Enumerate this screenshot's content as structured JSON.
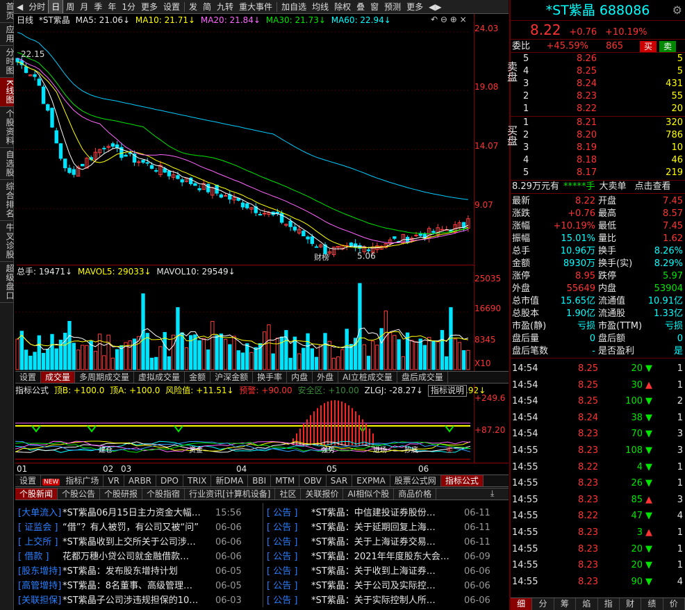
{
  "leftnav": [
    "首页",
    "应用",
    "分时图",
    "K线图",
    "个股资料",
    "自选股",
    "综合排名",
    "牛叉诊股",
    "超级盘口"
  ],
  "toolbar": [
    "分时",
    "日",
    "周",
    "月",
    "季",
    "年",
    "1分",
    "更多",
    "设置",
    "发",
    "简",
    "九转",
    "重大事件",
    "加自选",
    "均线",
    "除权",
    "叠",
    "窗",
    "预测",
    "更多"
  ],
  "kline": {
    "period": "日线",
    "name": "*ST紫晶",
    "ma5": "MA5: 21.06↓",
    "ma10": "MA10: 21.71↓",
    "ma20": "MA20: 21.84↓",
    "ma30": "MA30: 21.73↓",
    "ma60": "MA60: 22.94↓",
    "yticks": [
      "24.03",
      "19.08",
      "14.07",
      "9.07"
    ],
    "high_label": "22.15",
    "low_label": "5.06",
    "event_label": "财榜"
  },
  "volume": {
    "title": "总手: 19471↓",
    "mavol5": "MAVOL5: 29033↓",
    "mavol10": "MAVOL10: 29549↓",
    "yticks": [
      "25035",
      "16690",
      "8345"
    ],
    "unit": "X10"
  },
  "vol_tabs": [
    "设置",
    "成交量",
    "多周期成交量",
    "虚拟成交量",
    "金额",
    "沪深金额",
    "换手率",
    "内盘",
    "外盘",
    "AI立桩成交量",
    "盘后成交量"
  ],
  "indicator": {
    "title": "指标公式",
    "b": "顶B: +100.0",
    "a": "顶A: +100.0",
    "risk": "风险值: +11.51↓",
    "warn": "预警: +90.00",
    "safe": "安全区: +10.00",
    "zlgj": "ZLGJ: -28.27↓",
    "mazl": "MAZL: -7.92↓",
    "desc": "指标说明",
    "yticks": [
      "+249.6",
      "+87.20"
    ],
    "marks": [
      "建仓",
      "资金",
      "强势",
      "进场",
      "抄底",
      "卖"
    ]
  },
  "months": [
    "01",
    "02",
    "03",
    "04",
    "05",
    "06"
  ],
  "ind_tabs": [
    "设置",
    "指标广场",
    "VR",
    "ARBR",
    "DPO",
    "TRIX",
    "新DMA",
    "BBI",
    "MTM",
    "OBV",
    "SAR",
    "EXPMA",
    "股票公式网",
    "指标公式"
  ],
  "new_badge": "NEW",
  "news_tabs": [
    "个股新闻",
    "个股公告",
    "个股研报",
    "个股指宿",
    "行业资讯[计算机设备]",
    "社区",
    "关联报价",
    "AI相似个股",
    "商品价格"
  ],
  "news_left": [
    {
      "tag": "[大单流入]",
      "title": "*ST紫晶06月15日主力资金大幅…",
      "date": "15:56"
    },
    {
      "tag": "[ 证监会 ]",
      "title": "“借”？有人被罚，有公司又被“问”",
      "date": "06-06"
    },
    {
      "tag": "[ 上交所 ]",
      "title": "*ST紫晶收到上交所关于公司涉…",
      "date": "06-06"
    },
    {
      "tag": "[  借款  ]",
      "title": "花都万穗小贷公司就金融借款…",
      "date": "06-06"
    },
    {
      "tag": "[股东增持]",
      "title": "*ST紫晶：发布股东增持计划",
      "date": "06-05"
    },
    {
      "tag": "[高管增持]",
      "title": "*ST紫晶：8名董事、高级管理…",
      "date": "06-05"
    },
    {
      "tag": "[关联担保]",
      "title": "*ST紫晶子公司涉违规担保的10…",
      "date": "06-03"
    }
  ],
  "news_right": [
    {
      "tag": "[  公告  ]",
      "title": "*ST紫晶：中信建投证券股份…",
      "date": "06-11"
    },
    {
      "tag": "[  公告  ]",
      "title": "*ST紫晶：关于延期回复上海…",
      "date": "06-11"
    },
    {
      "tag": "[  公告  ]",
      "title": "*ST紫晶：关于上海证券交易…",
      "date": "06-11"
    },
    {
      "tag": "[  公告  ]",
      "title": "*ST紫晶：2021年年度股东大会…",
      "date": "06-09"
    },
    {
      "tag": "[  公告  ]",
      "title": "*ST紫晶：关于收到上海证券…",
      "date": "06-06"
    },
    {
      "tag": "[  公告  ]",
      "title": "*ST紫晶：关于公司及实际控…",
      "date": "06-06"
    },
    {
      "tag": "[  公告  ]",
      "title": "*ST紫晶：关于实际控制人所…",
      "date": "06-06"
    }
  ],
  "quote": {
    "name": "*ST紫晶",
    "code": "688086",
    "price": "8.22",
    "change": "+0.76",
    "pct": "+10.19%",
    "weibi_label": "委比",
    "weibi": "+45.59%",
    "weicha": "865",
    "buy": "买",
    "sell": "卖"
  },
  "sell_label": "卖盘",
  "buy_label": "买盘",
  "asks": [
    {
      "l": "5",
      "p": "8.26",
      "v": "5"
    },
    {
      "l": "4",
      "p": "8.25",
      "v": "5"
    },
    {
      "l": "3",
      "p": "8.24",
      "v": "431"
    },
    {
      "l": "2",
      "p": "8.23",
      "v": "55"
    },
    {
      "l": "1",
      "p": "8.22",
      "v": "20"
    }
  ],
  "bids": [
    {
      "l": "1",
      "p": "8.21",
      "v": "320"
    },
    {
      "l": "2",
      "p": "8.20",
      "v": "786"
    },
    {
      "l": "3",
      "p": "8.19",
      "v": "10"
    },
    {
      "l": "4",
      "p": "8.18",
      "v": "46"
    },
    {
      "l": "5",
      "p": "8.17",
      "v": "219"
    }
  ],
  "bigorder": {
    "amt": "8.29万元",
    "dir": "有",
    "stars": "*****手",
    "label": "大卖单",
    "link": "点击查看"
  },
  "stats": [
    [
      "最新",
      "8.22",
      "开盘",
      "7.45"
    ],
    [
      "涨跌",
      "+0.76",
      "最高",
      "8.57"
    ],
    [
      "涨幅",
      "+10.19%",
      "最低",
      "7.45"
    ],
    [
      "振幅",
      "15.01%",
      "量比",
      "1.62"
    ],
    [
      "总手",
      "10.96万",
      "换手",
      "8.26%"
    ],
    [
      "金额",
      "8930万",
      "换手(实)",
      "8.29%"
    ],
    [
      "涨停",
      "8.95",
      "跌停",
      "5.97"
    ],
    [
      "外盘",
      "55649",
      "内盘",
      "53904"
    ],
    [
      "总市值",
      "15.65亿",
      "流通值",
      "10.91亿"
    ],
    [
      "总股本",
      "1.90亿",
      "流通股",
      "1.33亿"
    ],
    [
      "市盈(静)",
      "亏损",
      "市盈(TTM)",
      "亏损"
    ],
    [
      "盘后量",
      "0",
      "盘后额",
      "0"
    ],
    [
      "盘后笔数",
      "-",
      "是否盈利",
      "是"
    ]
  ],
  "ticks": [
    [
      "14:54",
      "8.25",
      "20",
      "d",
      "1"
    ],
    [
      "14:54",
      "8.25",
      "30",
      "u",
      "1"
    ],
    [
      "14:54",
      "8.25",
      "100",
      "d",
      "2"
    ],
    [
      "14:54",
      "8.24",
      "38",
      "d",
      "1"
    ],
    [
      "14:54",
      "8.23",
      "70",
      "d",
      "3"
    ],
    [
      "14:55",
      "8.23",
      "108",
      "d",
      "3"
    ],
    [
      "14:55",
      "8.22",
      "4",
      "d",
      "1"
    ],
    [
      "14:55",
      "8.23",
      "26",
      "d",
      "1"
    ],
    [
      "14:55",
      "8.23",
      "85",
      "u",
      "3"
    ],
    [
      "14:55",
      "8.22",
      "47",
      "d",
      "4"
    ],
    [
      "14:55",
      "8.23",
      "3",
      "u",
      "1"
    ],
    [
      "14:55",
      "8.23",
      "20",
      "d",
      "1"
    ],
    [
      "14:55",
      "8.23",
      "20",
      "d",
      "1"
    ],
    [
      "14:55",
      "8.23",
      "90",
      "d",
      "4"
    ]
  ],
  "right_tabs": [
    "细",
    "分",
    "筹",
    "焰",
    "指",
    "财",
    "绩",
    "价"
  ]
}
